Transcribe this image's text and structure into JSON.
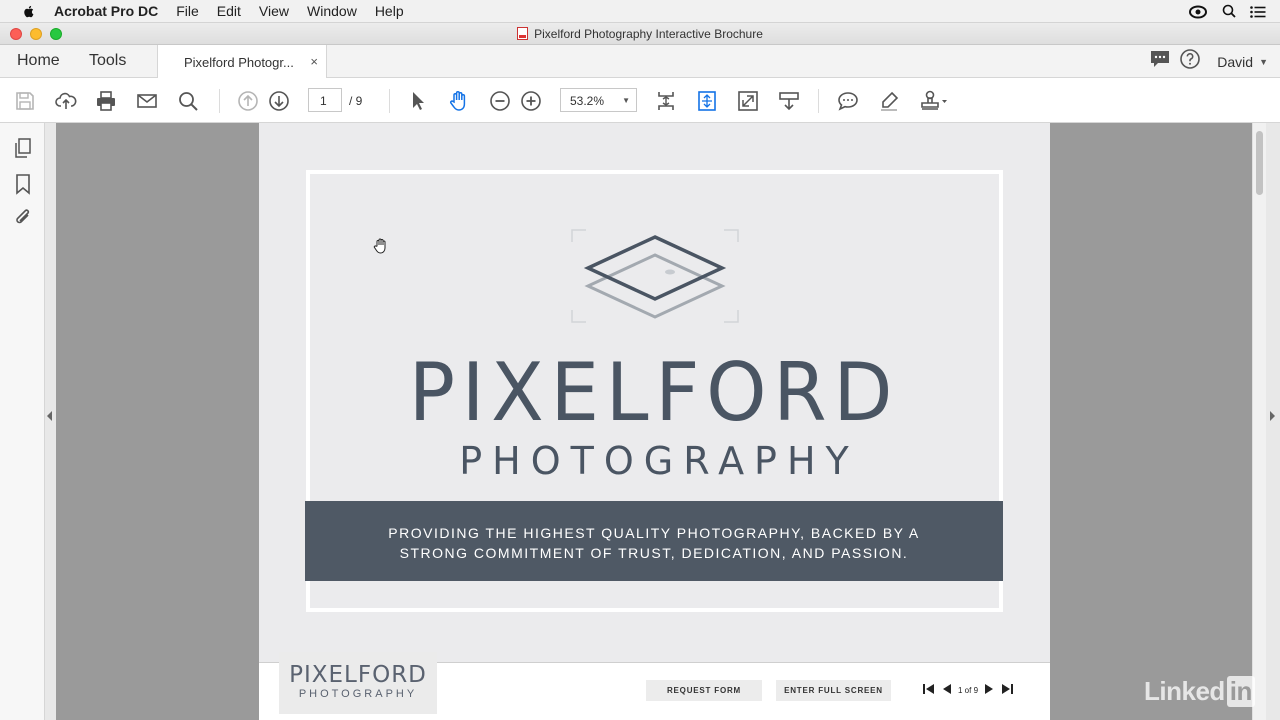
{
  "menubar": {
    "app_name": "Acrobat Pro DC",
    "items": [
      "File",
      "Edit",
      "View",
      "Window",
      "Help"
    ]
  },
  "window": {
    "title": "Pixelford Photography Interactive Brochure"
  },
  "tabbar": {
    "home_label": "Home",
    "tools_label": "Tools",
    "doc_tab_label": "Pixelford Photogr...",
    "close_glyph": "×",
    "user_name": "David"
  },
  "toolbar": {
    "current_page": "1",
    "page_total": "/ 9",
    "zoom": "53.2%"
  },
  "document": {
    "brand_main": "PIXELFORD",
    "brand_sub": "PHOTOGRAPHY",
    "banner_line1": "PROVIDING THE HIGHEST QUALITY PHOTOGRAPHY, BACKED BY A",
    "banner_line2": "STRONG COMMITMENT OF TRUST, DEDICATION, AND PASSION.",
    "footer": {
      "mini_main": "PIXELFORD",
      "mini_sub": "PHOTOGRAPHY",
      "request_form": "REQUEST FORM",
      "enter_full_screen": "ENTER FULL SCREEN",
      "pager_text": "1 of 9"
    }
  },
  "watermark": {
    "text": "Linked",
    "suffix": "in"
  },
  "colors": {
    "banner": "#4f5965",
    "brand_text": "#4a5563",
    "doc_background": "#9a9a9a",
    "accent_blue": "#1473e6"
  }
}
